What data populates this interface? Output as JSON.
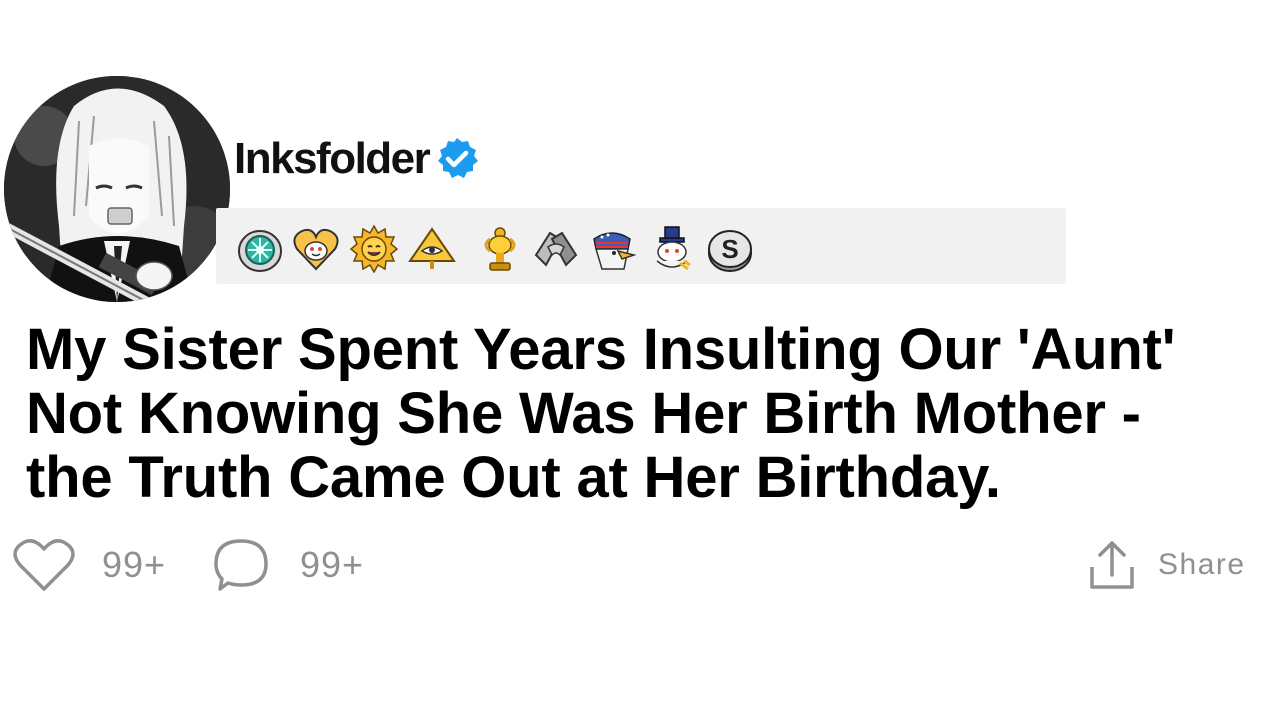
{
  "post": {
    "author": {
      "username": "Inksfolder",
      "verified": true,
      "avatar_icon": "anime-girl-with-sword-avatar"
    },
    "awards": [
      {
        "icon": "teal-globe-award-icon"
      },
      {
        "icon": "wholesome-heart-award-icon"
      },
      {
        "icon": "golden-sun-award-icon"
      },
      {
        "icon": "all-seeing-pyramid-award-icon"
      },
      {
        "icon": "gold-trophy-award-icon"
      },
      {
        "icon": "handshake-award-icon"
      },
      {
        "icon": "american-eagle-award-icon"
      },
      {
        "icon": "snoo-tophat-award-icon"
      },
      {
        "icon": "silver-coin-award-icon"
      }
    ],
    "title_lines": [
      "My Sister Spent Years Insulting Our 'Aunt'",
      "Not Knowing She Was Her Birth Mother -",
      "the Truth Came Out at Her Birthday."
    ],
    "actions": {
      "like_count": "99+",
      "comment_count": "99+",
      "share_label": "Share"
    },
    "colors": {
      "verified": "#1d9bf0",
      "action_gray": "#909090",
      "awards_bg": "#f1f1f1"
    }
  }
}
